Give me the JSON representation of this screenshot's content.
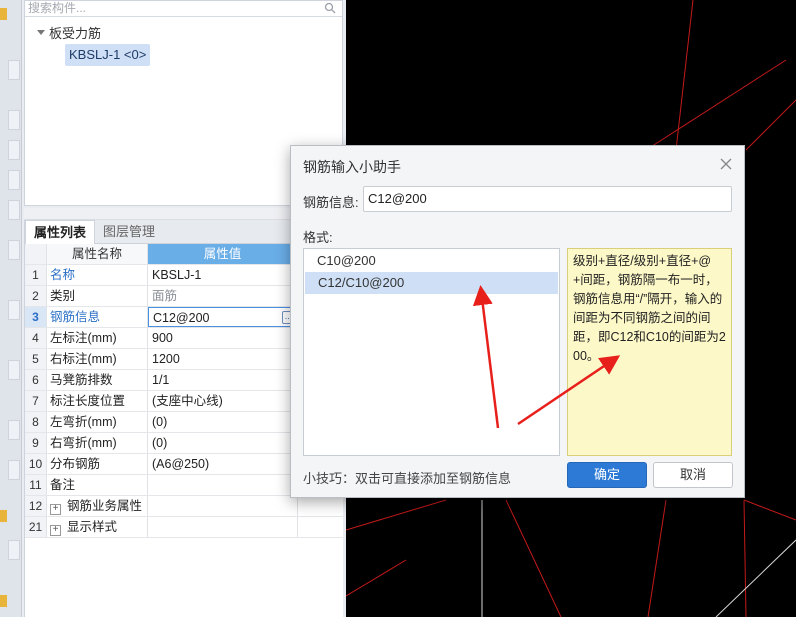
{
  "search": {
    "placeholder": "搜索构件..."
  },
  "tree": {
    "root_label": "板受力筋",
    "child_label": "KBSLJ-1 <0>"
  },
  "property_panel": {
    "tabs": [
      "属性列表",
      "图层管理"
    ],
    "headers": {
      "name": "属性名称",
      "value": "属性值"
    },
    "rows": [
      {
        "num": "1",
        "name": "名称",
        "value": "KBSLJ-1"
      },
      {
        "num": "2",
        "name": "类别",
        "value": "面筋"
      },
      {
        "num": "3",
        "name": "钢筋信息",
        "value": "C12@200"
      },
      {
        "num": "4",
        "name": "左标注(mm)",
        "value": "900"
      },
      {
        "num": "5",
        "name": "右标注(mm)",
        "value": "1200"
      },
      {
        "num": "6",
        "name": "马凳筋排数",
        "value": "1/1"
      },
      {
        "num": "7",
        "name": "标注长度位置",
        "value": "(支座中心线)"
      },
      {
        "num": "8",
        "name": "左弯折(mm)",
        "value": "(0)"
      },
      {
        "num": "9",
        "name": "右弯折(mm)",
        "value": "(0)"
      },
      {
        "num": "10",
        "name": "分布钢筋",
        "value": "(A6@250)"
      },
      {
        "num": "11",
        "name": "备注",
        "value": ""
      },
      {
        "num": "12",
        "name": "钢筋业务属性",
        "value": ""
      },
      {
        "num": "21",
        "name": "显示样式",
        "value": ""
      }
    ],
    "dots_label": "..."
  },
  "dialog": {
    "title": "钢筋输入小助手",
    "info_label": "钢筋信息:",
    "info_value": "C12@200",
    "format_label": "格式:",
    "formats": [
      "C10@200",
      "C12/C10@200"
    ],
    "description": "级别+直径/级别+直径+@+间距，钢筋隔一布一时，钢筋信息用“/”隔开，输入的间距为不同钢筋之间的间距，即C12和C10的间距为200。",
    "tip": "小技巧：双击可直接添加至钢筋信息",
    "ok_label": "确定",
    "cancel_label": "取消"
  },
  "colors": {
    "accent": "#2d7ad6",
    "header_blue": "#6aaee8",
    "selection": "#cfe0f6",
    "description_bg": "#fcf8c8",
    "annotation_arrow": "#e8201c",
    "cad_background": "#000000",
    "cad_line_red": "#c41a1a",
    "cad_line_white": "#d8d8d8"
  }
}
